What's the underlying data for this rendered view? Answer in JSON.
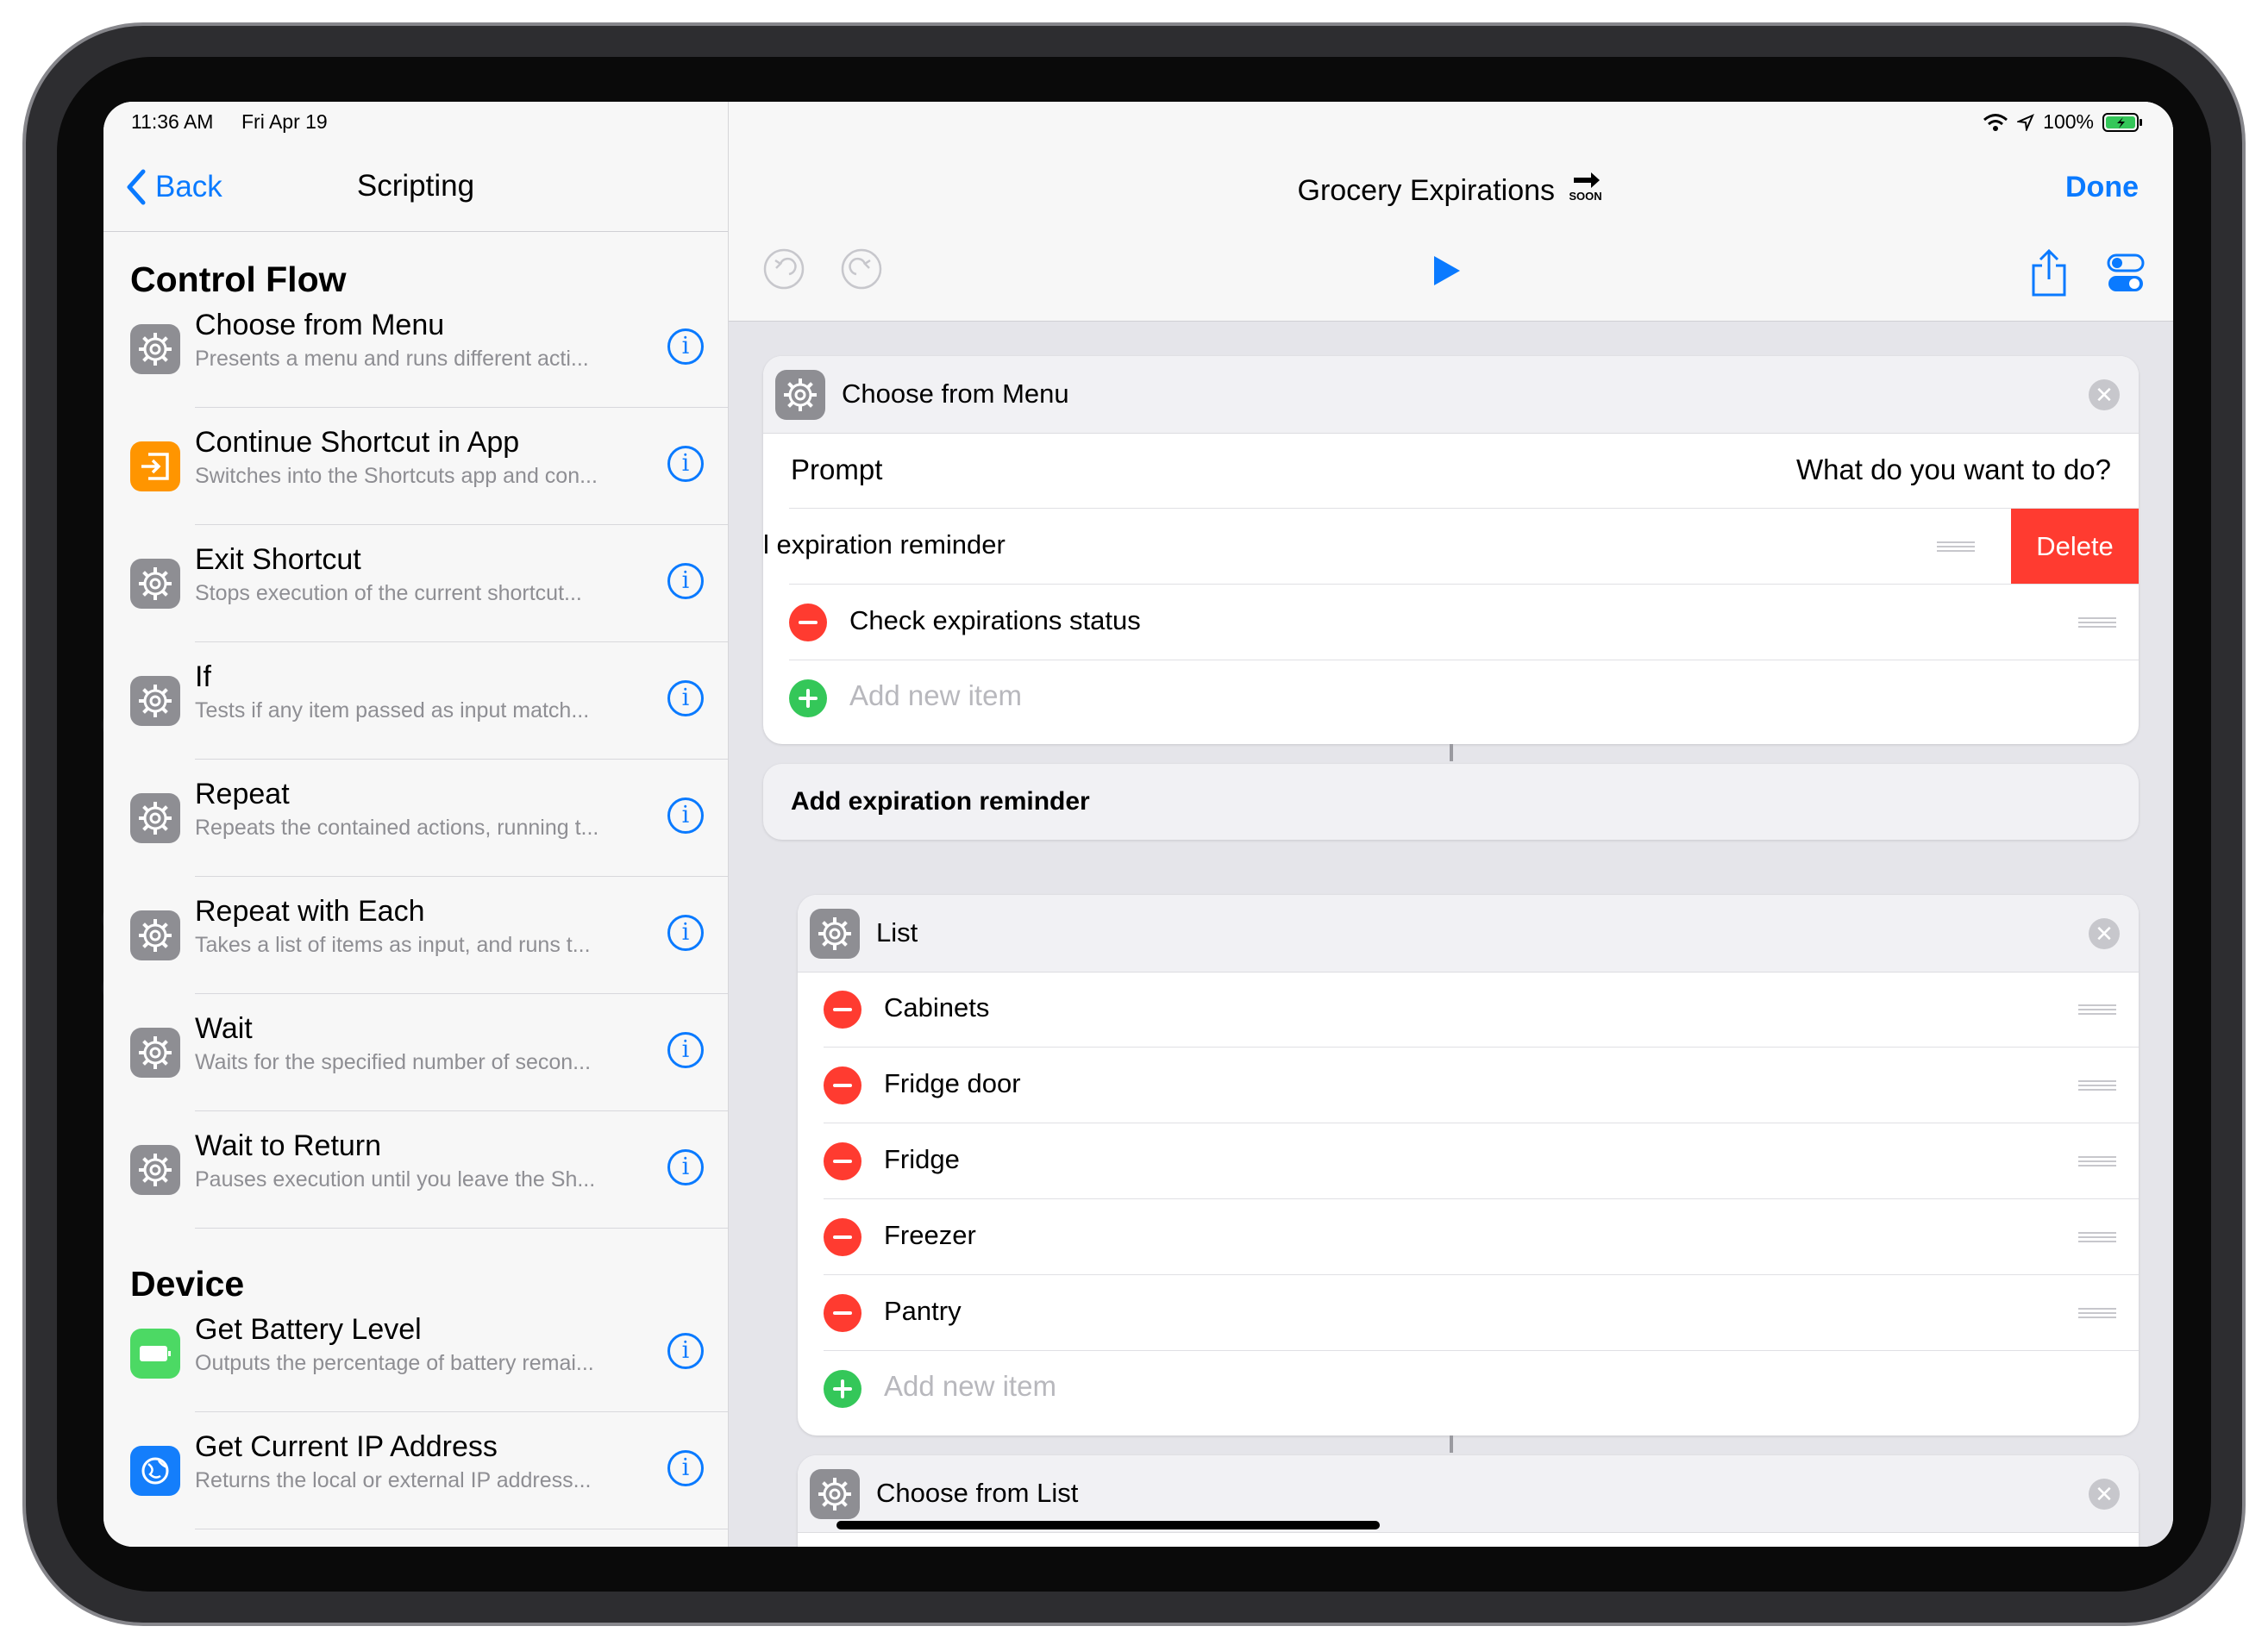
{
  "status_bar": {
    "time": "11:36 AM",
    "date": "Fri Apr 19",
    "battery": "100%"
  },
  "sidebar": {
    "back_label": "Back",
    "title": "Scripting",
    "sections": [
      {
        "title": "Control Flow",
        "items": [
          {
            "title": "Choose from Menu",
            "desc": "Presents a menu and runs different acti...",
            "icon": "gear-icon"
          },
          {
            "title": "Continue Shortcut in App",
            "desc": "Switches into the Shortcuts app and con...",
            "icon": "enter-app-icon"
          },
          {
            "title": "Exit Shortcut",
            "desc": "Stops execution of the current shortcut...",
            "icon": "gear-icon"
          },
          {
            "title": "If",
            "desc": "Tests if any item passed as input match...",
            "icon": "gear-icon"
          },
          {
            "title": "Repeat",
            "desc": "Repeats the contained actions, running t...",
            "icon": "gear-icon"
          },
          {
            "title": "Repeat with Each",
            "desc": "Takes a list of items as input, and runs t...",
            "icon": "gear-icon"
          },
          {
            "title": "Wait",
            "desc": "Waits for the specified number of secon...",
            "icon": "gear-icon"
          },
          {
            "title": "Wait to Return",
            "desc": "Pauses execution until you leave the Sh...",
            "icon": "gear-icon"
          }
        ]
      },
      {
        "title": "Device",
        "items": [
          {
            "title": "Get Battery Level",
            "desc": "Outputs the percentage of battery remai...",
            "icon": "battery-icon"
          },
          {
            "title": "Get Current IP Address",
            "desc": "Returns the local or external IP address...",
            "icon": "globe-icon"
          }
        ]
      }
    ]
  },
  "editor": {
    "title": "Grocery Expirations",
    "title_badge": "SOON",
    "done_label": "Done",
    "menu_card": {
      "title": "Choose from Menu",
      "prompt_label": "Prompt",
      "prompt_value": "What do you want to do?",
      "items": [
        "Add expiration reminder",
        "Check expirations status"
      ],
      "swiped_item_visible": "l expiration reminder",
      "delete_label": "Delete",
      "add_label": "Add new item"
    },
    "menu_case": "Add expiration reminder",
    "list_card": {
      "title": "List",
      "items": [
        "Cabinets",
        "Fridge door",
        "Fridge",
        "Freezer",
        "Pantry"
      ],
      "add_label": "Add new item"
    },
    "choose_list_card": {
      "title": "Choose from List"
    }
  },
  "colors": {
    "accent": "#0a7aff",
    "delete": "#ff3b30",
    "add": "#34c759",
    "orange": "#ff9500"
  }
}
